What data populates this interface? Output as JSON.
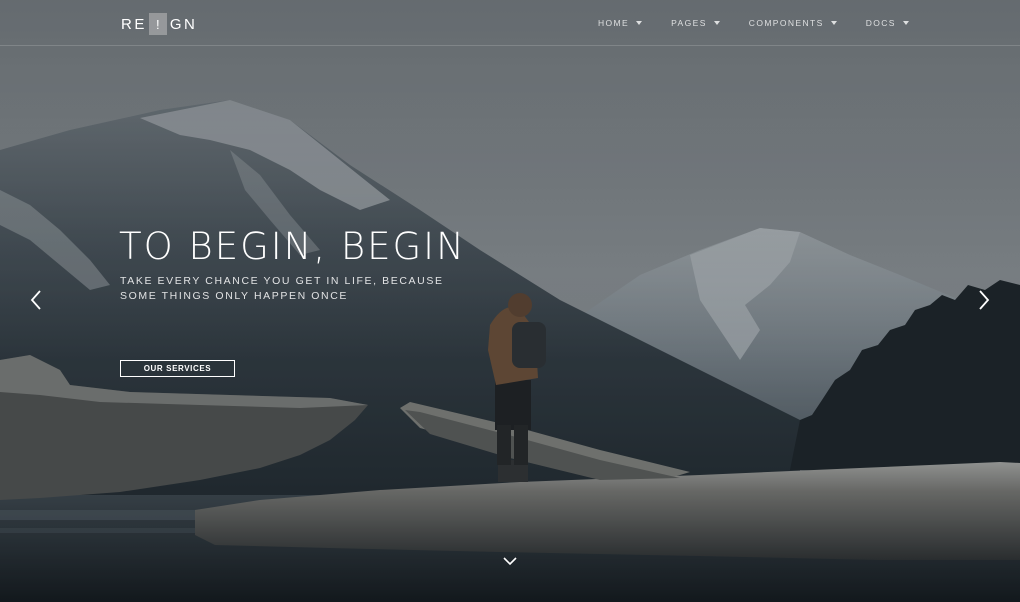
{
  "brand": {
    "left": "RE",
    "mark": "!",
    "right": "GN"
  },
  "nav": {
    "items": [
      {
        "label": "HOME"
      },
      {
        "label": "PAGES"
      },
      {
        "label": "COMPONENTS"
      },
      {
        "label": "DOCS"
      }
    ]
  },
  "hero": {
    "title": "TO BEGIN, BEGIN",
    "subtitle_line1": "TAKE EVERY CHANCE YOU GET IN LIFE, BECAUSE",
    "subtitle_line2": "SOME THINGS ONLY HAPPEN ONCE",
    "cta_label": "OUR SERVICES"
  },
  "slider": {
    "prev_icon": "chevron-left-icon",
    "next_icon": "chevron-right-icon",
    "scroll_icon": "chevron-down-icon"
  },
  "colors": {
    "text": "#ffffff",
    "overlay": "#2a3137",
    "mountain_far": "#8a939a",
    "mountain_near": "#27313a",
    "forest": "#171e22",
    "log": "#6e6d69",
    "water": "#161d22"
  }
}
